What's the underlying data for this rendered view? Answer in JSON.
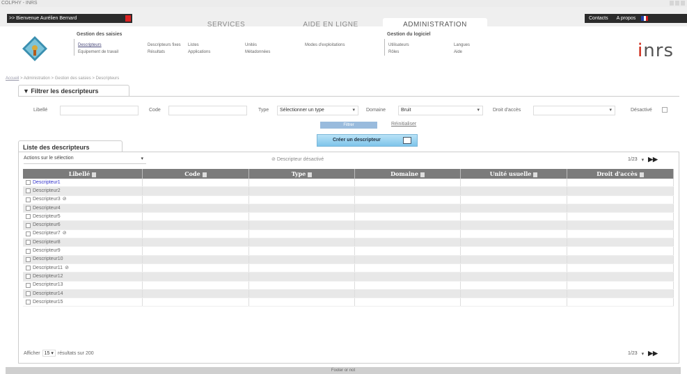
{
  "window": {
    "title": "COLPHY - INRS"
  },
  "topbar": {
    "welcome": ">> Bienvenue Aurélien Bernard",
    "tabs": [
      {
        "label": "SERVICES",
        "active": false
      },
      {
        "label": "AIDE EN LIGNE",
        "active": false
      },
      {
        "label": "ADMINISTRATION",
        "active": true
      }
    ],
    "contacts": "Contacts",
    "apropos": "A propos",
    "flag_colors": [
      "#1f3fa8",
      "#ffffff",
      "#d41a1a"
    ]
  },
  "menu": {
    "gestion_saisies": {
      "title": "Gestion des saisies",
      "col1": [
        "Descripteurs",
        "Equipement de travail"
      ],
      "col2": [
        "Descripteurs fixes",
        "Résultats"
      ],
      "col3": [
        "Listes",
        "Applications"
      ],
      "col4": [
        "Unités",
        "Métadonnées"
      ],
      "col5": [
        "Modes d'exploitations"
      ]
    },
    "gestion_logiciel": {
      "title": "Gestion du logiciel",
      "col1": [
        "Utilisateurs",
        "Rôles"
      ],
      "col2": [
        "Langues",
        "Aide"
      ]
    },
    "brand": "inrs"
  },
  "breadcrumb": {
    "home": "Accueil",
    "rest": " > Administration > Gestion des saisies > Descripteurs"
  },
  "filter": {
    "title": "Filtrer les descripteurs",
    "libelle_label": "Libellé",
    "code_label": "Code",
    "type_label": "Type",
    "type_value": "Sélectionner un type",
    "domaine_label": "Domaine",
    "domaine_value": "Bruit",
    "droit_label": "Droit d'accès",
    "desactive_label": "Désactivé",
    "filtrer_button": "Filtrer",
    "reinit_link": "Réinitialiser"
  },
  "create_button": "Créer un descripteur",
  "list": {
    "title": "Liste des descripteurs",
    "actions_label": "Actions sur le sélection",
    "legend": "Descripteur désactivé",
    "pager": "1/23",
    "columns": [
      "Libellé",
      "Code",
      "Type",
      "Domaine",
      "Unité usuelle",
      "Droit d'accès"
    ],
    "rows": [
      {
        "label": "Descripteur1",
        "disabled": false
      },
      {
        "label": "Descripteur2",
        "disabled": false
      },
      {
        "label": "Descripteur3",
        "disabled": true
      },
      {
        "label": "Descripteur4",
        "disabled": false
      },
      {
        "label": "Descripteur5",
        "disabled": false
      },
      {
        "label": "Descripteur6",
        "disabled": false
      },
      {
        "label": "Descripteur7",
        "disabled": true
      },
      {
        "label": "Descripteur8",
        "disabled": false
      },
      {
        "label": "Descripteur9",
        "disabled": false
      },
      {
        "label": "Descripteur10",
        "disabled": false
      },
      {
        "label": "Descripteur11",
        "disabled": true
      },
      {
        "label": "Descripteur12",
        "disabled": false
      },
      {
        "label": "Descripteur13",
        "disabled": false
      },
      {
        "label": "Descripteur14",
        "disabled": false
      },
      {
        "label": "Descripteur15",
        "disabled": false
      }
    ],
    "afficher_label": "Afficher",
    "afficher_value": "15",
    "results_label": "résultats sur 200"
  },
  "footer": "Footer or not"
}
